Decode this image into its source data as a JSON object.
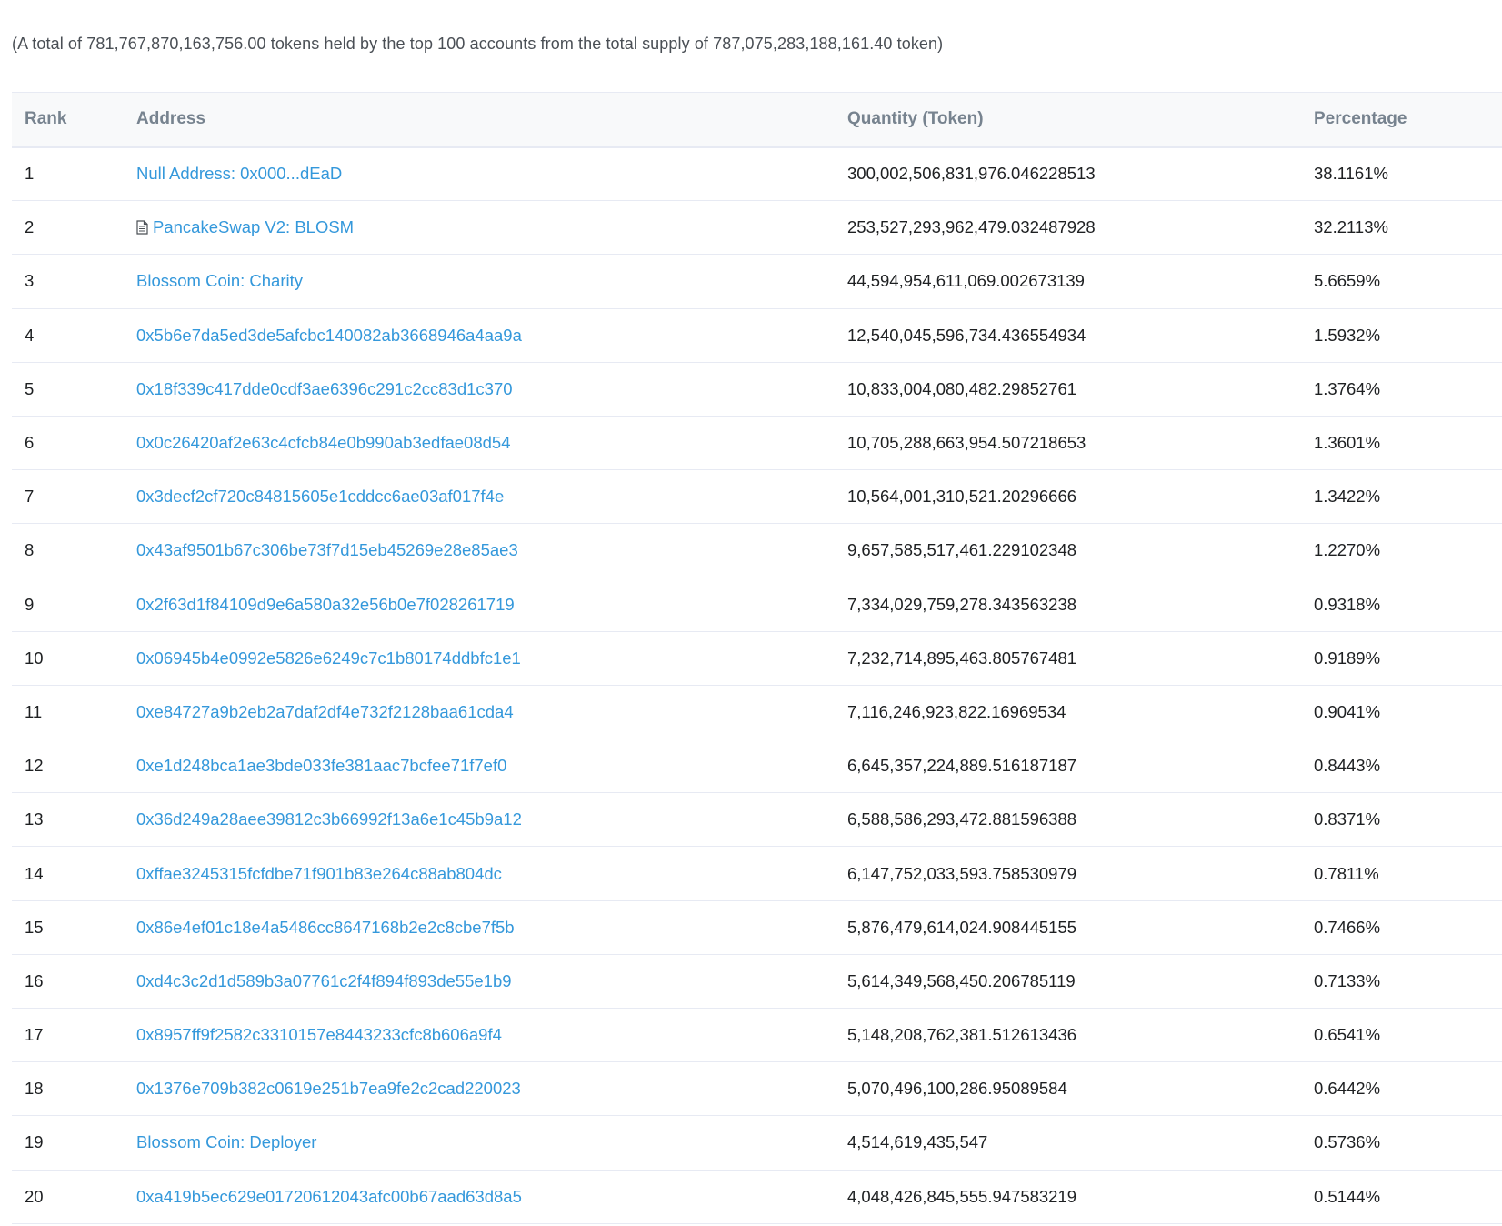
{
  "summary_text": "(A total of 781,767,870,163,756.00 tokens held by the top 100 accounts from the total supply of 787,075,283,188,161.40 token)",
  "table": {
    "headers": {
      "rank": "Rank",
      "address": "Address",
      "quantity": "Quantity (Token)",
      "percentage": "Percentage"
    },
    "rows": [
      {
        "rank": "1",
        "address": "Null Address: 0x000...dEaD",
        "contract": false,
        "quantity": "300,002,506,831,976.046228513",
        "percentage": "38.1161%"
      },
      {
        "rank": "2",
        "address": "PancakeSwap V2: BLOSM",
        "contract": true,
        "quantity": "253,527,293,962,479.032487928",
        "percentage": "32.2113%"
      },
      {
        "rank": "3",
        "address": "Blossom Coin: Charity",
        "contract": false,
        "quantity": "44,594,954,611,069.002673139",
        "percentage": "5.6659%"
      },
      {
        "rank": "4",
        "address": "0x5b6e7da5ed3de5afcbc140082ab3668946a4aa9a",
        "contract": false,
        "quantity": "12,540,045,596,734.436554934",
        "percentage": "1.5932%"
      },
      {
        "rank": "5",
        "address": "0x18f339c417dde0cdf3ae6396c291c2cc83d1c370",
        "contract": false,
        "quantity": "10,833,004,080,482.29852761",
        "percentage": "1.3764%"
      },
      {
        "rank": "6",
        "address": "0x0c26420af2e63c4cfcb84e0b990ab3edfae08d54",
        "contract": false,
        "quantity": "10,705,288,663,954.507218653",
        "percentage": "1.3601%"
      },
      {
        "rank": "7",
        "address": "0x3decf2cf720c84815605e1cddcc6ae03af017f4e",
        "contract": false,
        "quantity": "10,564,001,310,521.20296666",
        "percentage": "1.3422%"
      },
      {
        "rank": "8",
        "address": "0x43af9501b67c306be73f7d15eb45269e28e85ae3",
        "contract": false,
        "quantity": "9,657,585,517,461.229102348",
        "percentage": "1.2270%"
      },
      {
        "rank": "9",
        "address": "0x2f63d1f84109d9e6a580a32e56b0e7f028261719",
        "contract": false,
        "quantity": "7,334,029,759,278.343563238",
        "percentage": "0.9318%"
      },
      {
        "rank": "10",
        "address": "0x06945b4e0992e5826e6249c7c1b80174ddbfc1e1",
        "contract": false,
        "quantity": "7,232,714,895,463.805767481",
        "percentage": "0.9189%"
      },
      {
        "rank": "11",
        "address": "0xe84727a9b2eb2a7daf2df4e732f2128baa61cda4",
        "contract": false,
        "quantity": "7,116,246,923,822.16969534",
        "percentage": "0.9041%"
      },
      {
        "rank": "12",
        "address": "0xe1d248bca1ae3bde033fe381aac7bcfee71f7ef0",
        "contract": false,
        "quantity": "6,645,357,224,889.516187187",
        "percentage": "0.8443%"
      },
      {
        "rank": "13",
        "address": "0x36d249a28aee39812c3b66992f13a6e1c45b9a12",
        "contract": false,
        "quantity": "6,588,586,293,472.881596388",
        "percentage": "0.8371%"
      },
      {
        "rank": "14",
        "address": "0xffae3245315fcfdbe71f901b83e264c88ab804dc",
        "contract": false,
        "quantity": "6,147,752,033,593.758530979",
        "percentage": "0.7811%"
      },
      {
        "rank": "15",
        "address": "0x86e4ef01c18e4a5486cc8647168b2e2c8cbe7f5b",
        "contract": false,
        "quantity": "5,876,479,614,024.908445155",
        "percentage": "0.7466%"
      },
      {
        "rank": "16",
        "address": "0xd4c3c2d1d589b3a07761c2f4f894f893de55e1b9",
        "contract": false,
        "quantity": "5,614,349,568,450.206785119",
        "percentage": "0.7133%"
      },
      {
        "rank": "17",
        "address": "0x8957ff9f2582c3310157e8443233cfc8b606a9f4",
        "contract": false,
        "quantity": "5,148,208,762,381.512613436",
        "percentage": "0.6541%"
      },
      {
        "rank": "18",
        "address": "0x1376e709b382c0619e251b7ea9fe2c2cad220023",
        "contract": false,
        "quantity": "5,070,496,100,286.95089584",
        "percentage": "0.6442%"
      },
      {
        "rank": "19",
        "address": "Blossom Coin: Deployer",
        "contract": false,
        "quantity": "4,514,619,435,547",
        "percentage": "0.5736%"
      },
      {
        "rank": "20",
        "address": "0xa419b5ec629e01720612043afc00b67aad63d8a5",
        "contract": false,
        "quantity": "4,048,426,845,555.947583219",
        "percentage": "0.5144%"
      }
    ]
  },
  "colors": {
    "link": "#3498db",
    "header_text": "#77838f",
    "border": "#e7eaf3"
  },
  "icons": {
    "contract": "contract-file-icon"
  }
}
